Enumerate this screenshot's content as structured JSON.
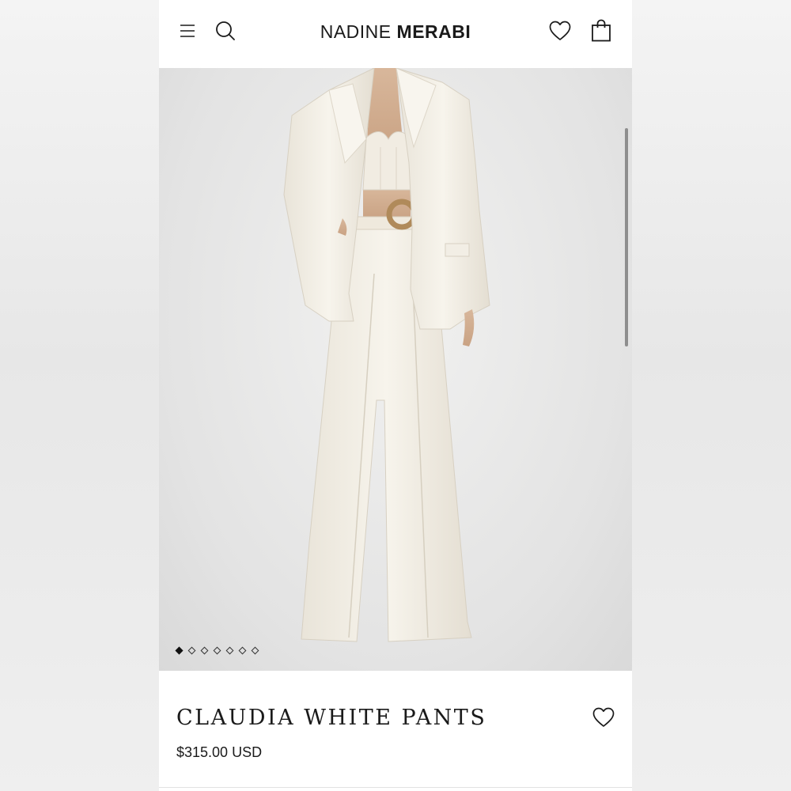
{
  "brand": {
    "name_light": "NADINE ",
    "name_bold": "MERABI"
  },
  "header": {
    "icons": [
      "menu-icon",
      "search-icon",
      "heart-icon",
      "bag-icon"
    ]
  },
  "gallery": {
    "image_count": 7,
    "active_index": 0
  },
  "product": {
    "title": "CLAUDIA WHITE PANTS",
    "price": "$315.00 USD"
  },
  "colors": {
    "text": "#1a1a1a",
    "background": "#ffffff",
    "garment": "#f3efe6",
    "belt_buckle": "#b08a5a"
  }
}
